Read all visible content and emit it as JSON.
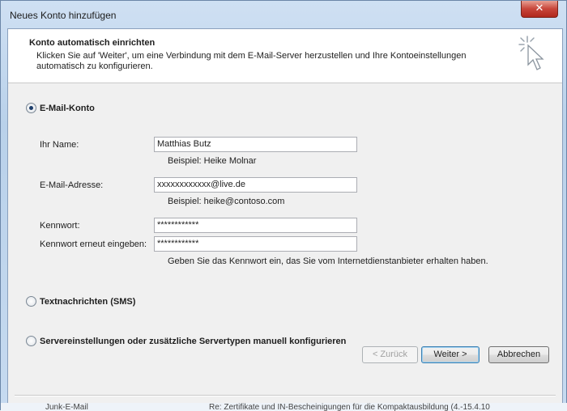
{
  "window": {
    "title": "Neues Konto hinzufügen",
    "close_glyph": "✕"
  },
  "header": {
    "title": "Konto automatisch einrichten",
    "subtitle": "Klicken Sie auf 'Weiter', um eine Verbindung mit dem E-Mail-Server herzustellen und Ihre Kontoeinstellungen automatisch zu konfigurieren.",
    "icon": "wizard-cursor-icon"
  },
  "options": {
    "email_account": {
      "label": "E-Mail-Konto",
      "selected": true
    },
    "sms": {
      "label": "Textnachrichten (SMS)",
      "selected": false
    },
    "manual": {
      "label": "Servereinstellungen oder zusätzliche Servertypen manuell konfigurieren",
      "selected": false
    }
  },
  "form": {
    "name": {
      "label": "Ihr Name:",
      "value": "Matthias Butz",
      "hint": "Beispiel: Heike Molnar"
    },
    "email": {
      "label": "E-Mail-Adresse:",
      "value": "xxxxxxxxxxxx@live.de",
      "hint": "Beispiel: heike@contoso.com"
    },
    "password": {
      "label": "Kennwort:",
      "value": "************"
    },
    "password_repeat": {
      "label": "Kennwort erneut eingeben:",
      "value": "************"
    },
    "password_hint": "Geben Sie das Kennwort ein, das Sie vom Internetdienstanbieter erhalten haben."
  },
  "buttons": {
    "back": "< Zurück",
    "next": "Weiter >",
    "cancel": "Abbrechen"
  },
  "background": {
    "left_text": "Junk-E-Mail",
    "right_text": "Re: Zertifikate und IN-Bescheinigungen für die Kompaktausbildung (4.-15.4.10"
  }
}
